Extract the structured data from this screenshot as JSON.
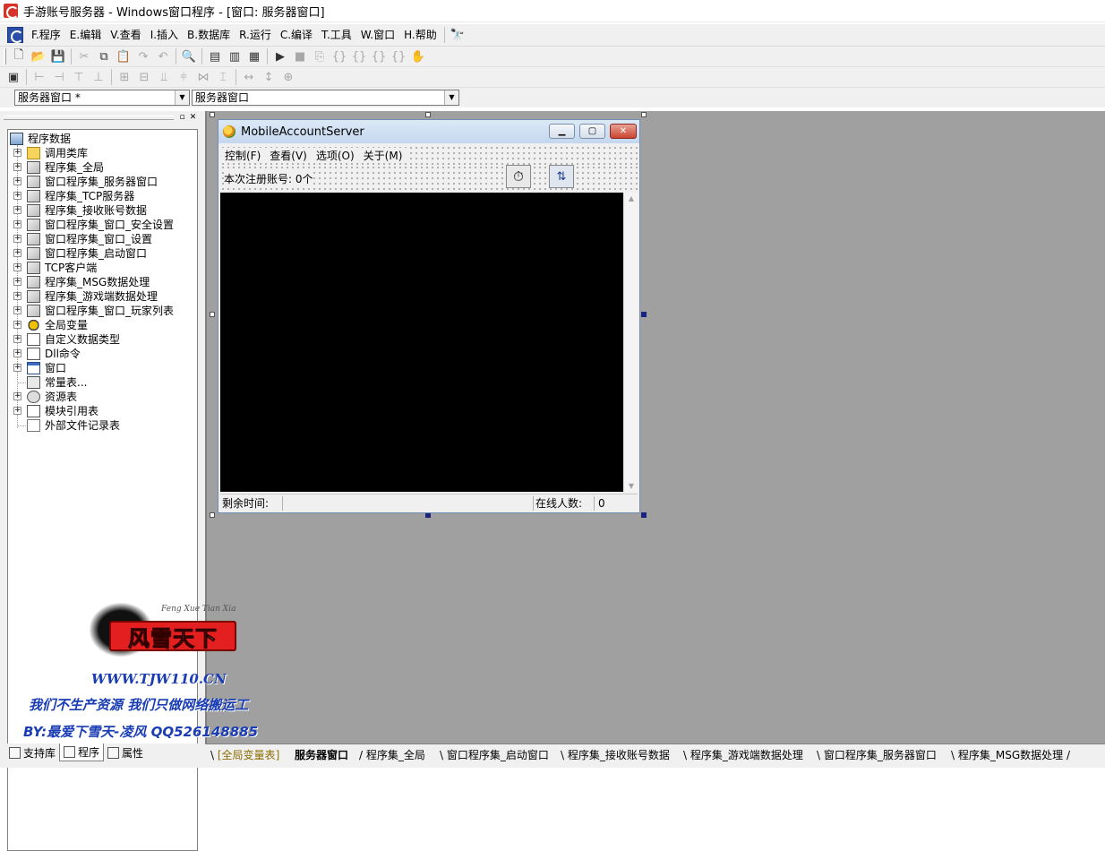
{
  "window": {
    "title": "手游账号服务器 - Windows窗口程序 - [窗口: 服务器窗口]"
  },
  "menubar": [
    "F.程序",
    "E.编辑",
    "V.查看",
    "I.插入",
    "B.数据库",
    "R.运行",
    "C.编译",
    "T.工具",
    "W.窗口",
    "H.帮助"
  ],
  "combos": {
    "left": "服务器窗口 *",
    "right": "服务器窗口"
  },
  "tree": {
    "root": "程序数据",
    "items": [
      "调用类库",
      "程序集_全局",
      "窗口程序集_服务器窗口",
      "程序集_TCP服务器",
      "程序集_接收账号数据",
      "窗口程序集_窗口_安全设置",
      "窗口程序集_窗口_设置",
      "窗口程序集_启动窗口",
      "TCP客户端",
      "程序集_MSG数据处理",
      "程序集_游戏端数据处理",
      "窗口程序集_窗口_玩家列表",
      "全局变量",
      "自定义数据类型",
      "Dll命令",
      "窗口",
      "常量表...",
      "资源表",
      "模块引用表",
      "外部文件记录表"
    ]
  },
  "left_tabs": [
    "支持库",
    "程序",
    "属性"
  ],
  "form": {
    "title": "MobileAccountServer",
    "menu": [
      "控制(F)",
      "查看(V)",
      "选项(O)",
      "关于(M)"
    ],
    "label_registered": "本次注册账号: 0个",
    "status": {
      "remaining_label": "剩余时间:",
      "online_label": "在线人数:",
      "online_value": "0"
    }
  },
  "bottom_tabs": [
    "全局变量表",
    "服务器窗口",
    "程序集_全局",
    "窗口程序集_启动窗口",
    "程序集_接收账号数据",
    "程序集_游戏端数据处理",
    "窗口程序集_服务器窗口",
    "程序集_MSG数据处理"
  ],
  "watermark": {
    "logo": "风雪天下",
    "script": "Feng Xue Tian Xia",
    "url": "WWW.TJW110.CN",
    "slogan": "我们不生产资源  我们只做网络搬运工",
    "author": "BY:最爱下雪天-凌风 QQ526148885"
  },
  "colors": {
    "design_bg": "#a0a0a0",
    "console_bg": "#000000",
    "tab_active_text": "#8a6d00",
    "watermark_text": "#1a3db4"
  }
}
